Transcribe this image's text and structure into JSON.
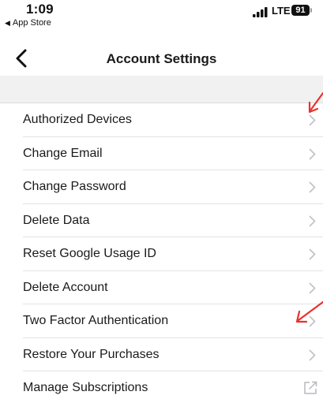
{
  "status_bar": {
    "time": "1:09",
    "back_app": "App Store",
    "network": "LTE",
    "battery": "91"
  },
  "nav": {
    "title": "Account Settings",
    "back_icon": "chevron-left-icon"
  },
  "items": [
    {
      "label": "Authorized Devices",
      "accessory": "chevron-right-icon"
    },
    {
      "label": "Change Email",
      "accessory": "chevron-right-icon"
    },
    {
      "label": "Change Password",
      "accessory": "chevron-right-icon"
    },
    {
      "label": "Delete Data",
      "accessory": "chevron-right-icon"
    },
    {
      "label": "Reset Google Usage ID",
      "accessory": "chevron-right-icon"
    },
    {
      "label": "Delete Account",
      "accessory": "chevron-right-icon"
    },
    {
      "label": "Two Factor Authentication",
      "accessory": "chevron-right-icon"
    },
    {
      "label": "Restore Your Purchases",
      "accessory": "chevron-right-icon"
    },
    {
      "label": "Manage Subscriptions",
      "accessory": "external-link-icon"
    }
  ],
  "colors": {
    "annotation_arrow": "#e8322f",
    "chevron": "#c4c4c7",
    "section_background": "#f1f1f2"
  }
}
